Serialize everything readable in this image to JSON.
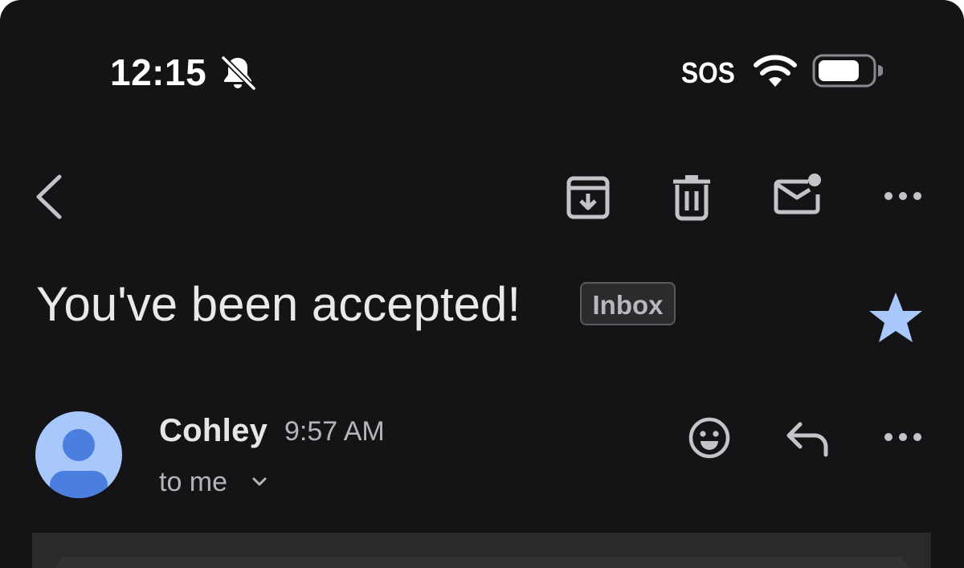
{
  "status_bar": {
    "time": "12:15",
    "carrier": "SOS",
    "icons": [
      "bell-slash-icon",
      "wifi-icon",
      "battery-icon"
    ]
  },
  "toolbar": {
    "icons": [
      "back-icon",
      "archive-icon",
      "delete-icon",
      "mark-unread-icon",
      "more-icon"
    ]
  },
  "email": {
    "subject": "You've been accepted!",
    "label": "Inbox",
    "starred": true,
    "sender": "Cohley",
    "time": "9:57 AM",
    "recipient": "to me"
  },
  "colors": {
    "background": "#141416",
    "star": "#a8c7fa",
    "avatar_bg": "#a8c7fa",
    "avatar_fg": "#4a7fe0"
  }
}
